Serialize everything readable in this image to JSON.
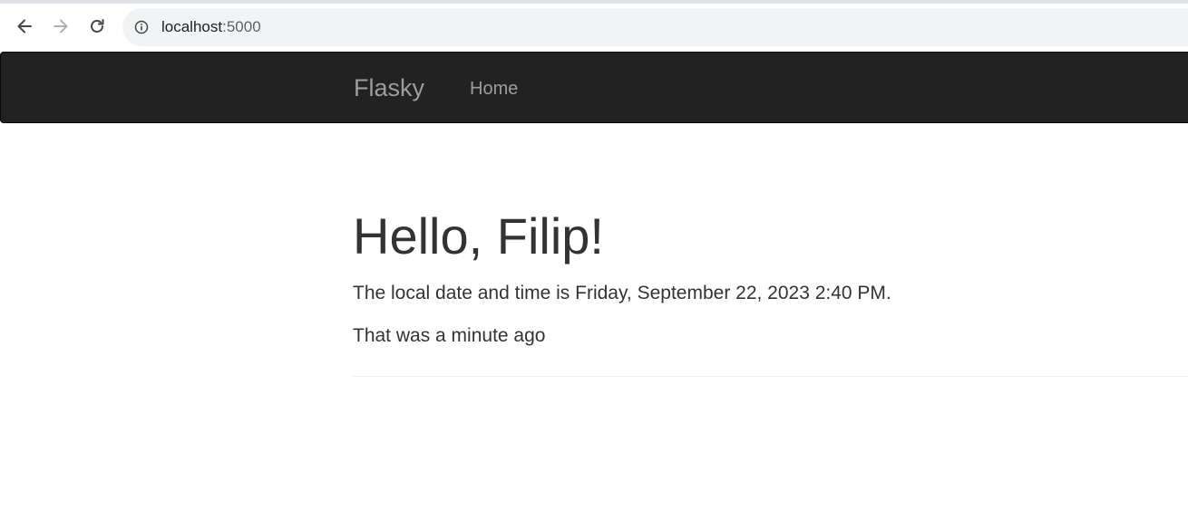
{
  "browser": {
    "url_host": "localhost",
    "url_port": ":5000"
  },
  "navbar": {
    "brand": "Flasky",
    "items": [
      {
        "label": "Home"
      }
    ]
  },
  "content": {
    "greeting": "Hello, Filip!",
    "datetime_text": "The local date and time is Friday, September 22, 2023 2:40 PM.",
    "relative_text": "That was a minute ago"
  },
  "colors": {
    "navbar_bg": "#222222",
    "nav_text": "#9d9d9d",
    "body_text": "#333333"
  },
  "icons": {
    "back": "arrow-left",
    "forward": "arrow-right",
    "reload": "reload",
    "site_info": "info-circle"
  }
}
